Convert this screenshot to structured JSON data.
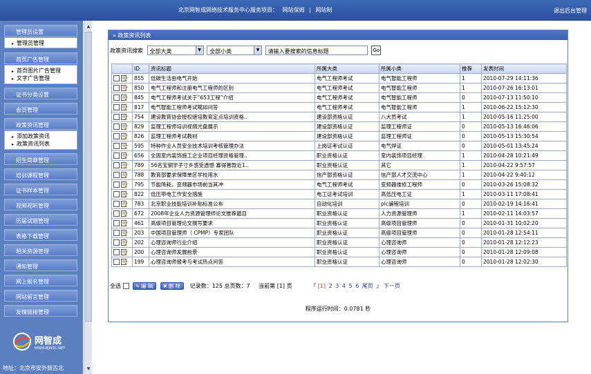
{
  "header": {
    "project_label": "北京网智成网络技术服务中心服务项目：",
    "links": [
      "网站保姆",
      "网站制"
    ],
    "logout": "退出后台管理"
  },
  "sidebar": {
    "groups": [
      {
        "title": "管理员设置",
        "items": [
          "管理员管理"
        ]
      },
      {
        "title": "首页广告管理",
        "items": [
          "首页图片广告管理",
          "文字广告管理"
        ]
      },
      {
        "title": "证书分类设置",
        "items": []
      },
      {
        "title": "会员管理",
        "items": []
      },
      {
        "title": "政策资讯管理",
        "items": [
          "添加政策资讯",
          "政策资讯列表"
        ]
      },
      {
        "title": "招生简章管理",
        "items": []
      },
      {
        "title": "培训课程管理",
        "items": []
      },
      {
        "title": "证书样本管理",
        "items": []
      },
      {
        "title": "视频视听管理",
        "items": []
      },
      {
        "title": "历届试题管理",
        "items": []
      },
      {
        "title": "表格下载管理",
        "items": []
      },
      {
        "title": "相关资源管理",
        "items": []
      },
      {
        "title": "通知管理",
        "items": []
      },
      {
        "title": "网上报名管理",
        "items": []
      },
      {
        "title": "网站留言管理",
        "items": []
      },
      {
        "title": "友情链接管理",
        "items": []
      }
    ],
    "brand": {
      "name": "网智成",
      "url": "WWW.BJWZC.NET"
    },
    "address": "地址：北京市安外鼓古北"
  },
  "panel": {
    "title": "政策资讯列表",
    "search": {
      "label": "政策资讯搜索",
      "category": "全部大类",
      "subcategory": "全部小类",
      "keyword_placeholder": "请输入要搜索的信息标题",
      "go": "Go"
    },
    "columns": [
      "ID",
      "资讯标题",
      "所属大类",
      "所属小类",
      "推荐",
      "发表时间"
    ],
    "rows": [
      [
        "855",
        "低碳生活由电气开始",
        "电气工程师考试",
        "电气智能工程师",
        "1",
        "2010-07-29 14:11:36"
      ],
      [
        "850",
        "电气工程师和注册电气工程师的区别",
        "电气工程师考试",
        "电气智能工程师",
        "1",
        "2010-07-26 16:13:01"
      ],
      [
        "845",
        "电气工程师考试关于“653工程”介绍",
        "电气工程师考试",
        "电气智能工程师",
        "0",
        "2010-07-13 11:50:10"
      ],
      [
        "817",
        "电气智能工程师考试噶如问答",
        "电气工程师考试",
        "电气智能工程师",
        "1",
        "2010-06-22 15:12:30"
      ],
      [
        "754",
        "建设教育协会授权继培教育定点培训资格..",
        "建设部资格认证",
        "八大员考试",
        "1",
        "2010-05-16 11:25:00"
      ],
      [
        "829",
        "监理工程师培训视频光盘展示",
        "建设部资格认证",
        "监理工程师证",
        "0",
        "2010-05-13 16:46:06"
      ],
      [
        "826",
        "监理工程师考试教材",
        "建设部资格认证",
        "监理工程师证",
        "0",
        "2010-05-13 15:30:54"
      ],
      [
        "595",
        "特种作业人员安全技术培训考核管理办法",
        "上岗证考试认证",
        "电气焊证",
        "0",
        "2010-05-01 13:45:24"
      ],
      [
        "656",
        "全国室内装饰施工企业项目经理资格管理..",
        "职业资格认证",
        "室内装饰项目经理",
        "1",
        "2010-04-28 10:21:49"
      ],
      [
        "789",
        "56名宝钢学子寸乡感受遗憾 寡得善款近1..",
        "职业资格认证",
        "其它",
        "1",
        "2010-04-22 9:57:57"
      ],
      [
        "788",
        "教育部要求保障单区学校用水",
        "信产部资格认证",
        "信产部人才交流中心",
        "1",
        "2010-04-22 9:40:12"
      ],
      [
        "795",
        "节能降耗，变频器市场前当其冲",
        "电气工程师考试",
        "变频器维修工程师",
        "0",
        "2010-03-26 15:08:32"
      ],
      [
        "822",
        "低压带电工作安全措施",
        "电工证考试培训",
        "高低压电工证",
        "1",
        "2010-03-11 17:08:41"
      ],
      [
        "783",
        "北京职业技能培训补贴标准公布",
        "自动化培训",
        "plc编程培训",
        "0",
        "2010-02-19 14:16:41"
      ],
      [
        "672",
        "2008年企业人力资源管理师论文推荐题目",
        "职业资格认证",
        "人力资源管理师",
        "1",
        "2010-02-11 14:03:57"
      ],
      [
        "461",
        "高级项目管理论文撰写要求",
        "职业资格认证",
        "高级项目管理师",
        "0",
        "2010-01-31 10:02:20"
      ],
      [
        "203",
        "中国项目管理师（ CPMP）专家团队",
        "职业资格认证",
        "高级项目管理师",
        "0",
        "2010-01-28 12:54:11"
      ],
      [
        "202",
        "心理咨询师行业介绍",
        "职业资格认证",
        "心理咨询师",
        "0",
        "2010-01-28 12:12:23"
      ],
      [
        "200",
        "心理咨询师发展前景",
        "职业资格认证",
        "心理咨询师",
        "0",
        "2010-01-28 12:09:08"
      ],
      [
        "199",
        "心理咨询师报考与考试热点问答",
        "职业资格认证",
        "心理咨询师",
        "0",
        "2010-01-28 12:02:30"
      ]
    ],
    "footer": {
      "select_all": "全选",
      "edit": "编 辑",
      "delete": "删 除",
      "records": "记录数：125 总页数：7",
      "current": "当前第 [1] 页",
      "pager_prefix": "『",
      "pages": [
        "[1]",
        "2",
        "3",
        "4",
        "5",
        "6",
        "尾页"
      ],
      "pager_suffix": "』",
      "next": "下一页"
    },
    "runtime": "程序运行时间：0.0781 秒"
  }
}
